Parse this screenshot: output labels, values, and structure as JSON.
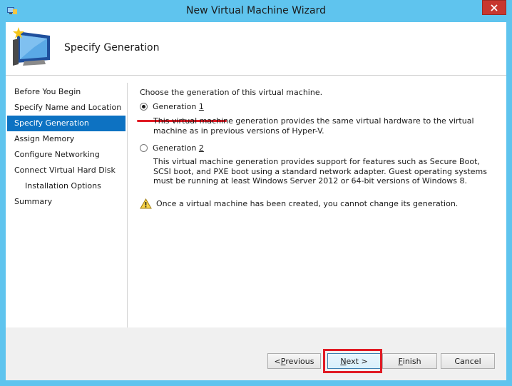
{
  "window": {
    "title": "New Virtual Machine Wizard",
    "close_icon": "close-icon"
  },
  "header": {
    "title": "Specify Generation",
    "icon": "virtual-machine-wizard-icon"
  },
  "nav": {
    "items": [
      {
        "label": "Before You Begin",
        "active": false,
        "sub": false
      },
      {
        "label": "Specify Name and Location",
        "active": false,
        "sub": false
      },
      {
        "label": "Specify Generation",
        "active": true,
        "sub": false
      },
      {
        "label": "Assign Memory",
        "active": false,
        "sub": false
      },
      {
        "label": "Configure Networking",
        "active": false,
        "sub": false
      },
      {
        "label": "Connect Virtual Hard Disk",
        "active": false,
        "sub": false
      },
      {
        "label": "Installation Options",
        "active": false,
        "sub": true
      },
      {
        "label": "Summary",
        "active": false,
        "sub": false
      }
    ]
  },
  "content": {
    "prompt": "Choose the generation of this virtual machine.",
    "gen1": {
      "label": "Generation ",
      "accel": "1",
      "selected": true,
      "description": "This virtual machine generation provides the same virtual hardware to the virtual machine as in previous versions of Hyper-V."
    },
    "gen2": {
      "label": "Generation ",
      "accel": "2",
      "selected": false,
      "description": "This virtual machine generation provides support for features such as Secure Boot, SCSI boot, and PXE boot using a standard network adapter. Guest operating systems must be running at least Windows Server 2012 or 64-bit versions of Windows 8."
    },
    "warning": "Once a virtual machine has been created, you cannot change its generation."
  },
  "footer": {
    "previous": {
      "pre": "< ",
      "accel": "P",
      "post": "revious"
    },
    "next": {
      "accel": "N",
      "post": "ext >"
    },
    "finish": {
      "accel": "F",
      "post": "inish"
    },
    "cancel": "Cancel"
  },
  "colors": {
    "window_frame": "#5fc4ee",
    "nav_active": "#0d72c2",
    "close_button": "#c7372f",
    "annotation_red": "#e01b24"
  }
}
